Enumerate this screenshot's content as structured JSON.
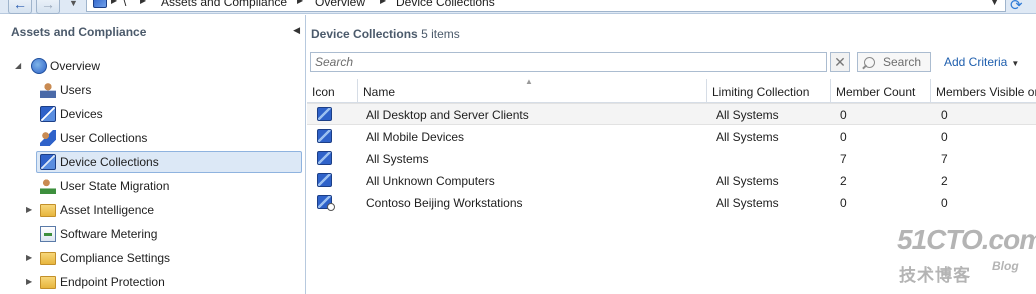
{
  "address_bar": {
    "breadcrumbs": [
      "\\",
      "Assets and Compliance",
      "Overview",
      "Device Collections"
    ],
    "back_icon": "arrow-left-icon",
    "forward_icon": "arrow-right-icon",
    "refresh_icon": "refresh-icon"
  },
  "nav": {
    "header": "Assets and Compliance",
    "items": [
      {
        "label": "Overview",
        "icon": "overview-icon"
      },
      {
        "label": "Users",
        "icon": "user-icon"
      },
      {
        "label": "Devices",
        "icon": "device-icon"
      },
      {
        "label": "User Collections",
        "icon": "user-collection-icon"
      },
      {
        "label": "Device Collections",
        "icon": "device-collection-icon",
        "selected": true
      },
      {
        "label": "User State Migration",
        "icon": "migration-icon"
      },
      {
        "label": "Asset Intelligence",
        "icon": "folder-icon"
      },
      {
        "label": "Software Metering",
        "icon": "metering-icon"
      },
      {
        "label": "Compliance Settings",
        "icon": "folder-icon"
      },
      {
        "label": "Endpoint Protection",
        "icon": "folder-icon"
      }
    ]
  },
  "content": {
    "title": "Device Collections",
    "count": "5 items",
    "search_placeholder": "Search",
    "search_button": "Search",
    "add_criteria": "Add Criteria",
    "columns": [
      "Icon",
      "Name",
      "Limiting Collection",
      "Member Count",
      "Members Visible on Site"
    ],
    "rows": [
      {
        "name": "All Desktop and Server Clients",
        "limiting": "All Systems",
        "member_count": "0",
        "visible": "0"
      },
      {
        "name": "All Mobile Devices",
        "limiting": "All Systems",
        "member_count": "0",
        "visible": "0"
      },
      {
        "name": "All Systems",
        "limiting": "",
        "member_count": "7",
        "visible": "7"
      },
      {
        "name": "All Unknown Computers",
        "limiting": "All Systems",
        "member_count": "2",
        "visible": "2"
      },
      {
        "name": "Contoso Beijing Workstations",
        "limiting": "All Systems",
        "member_count": "0",
        "visible": "0"
      }
    ]
  },
  "watermark": {
    "main": "51CTO.com",
    "sub": "技术博客",
    "blog": "Blog"
  }
}
